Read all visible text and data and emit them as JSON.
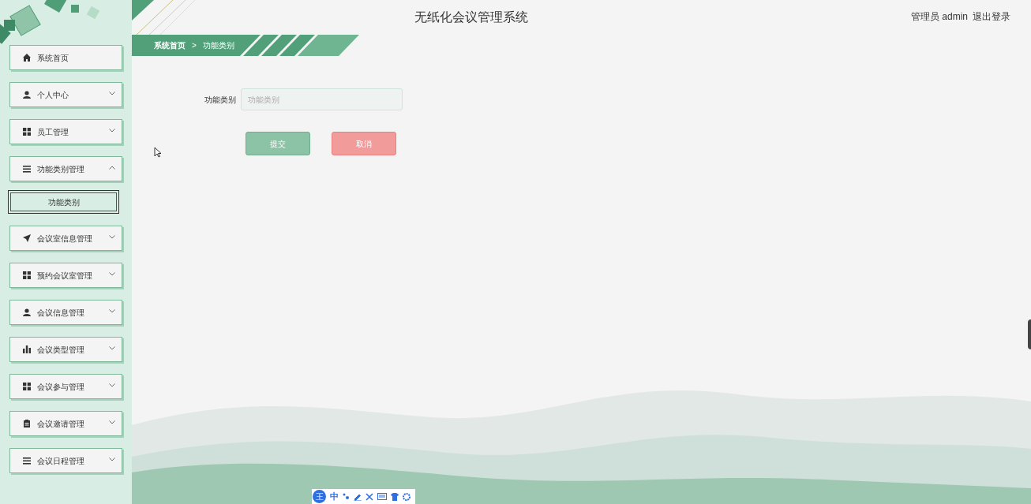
{
  "header": {
    "title": "无纸化会议管理系统",
    "user": "管理员 admin",
    "logout": "退出登录"
  },
  "breadcrumb": [
    "系统首页",
    "功能类别"
  ],
  "breadcrumb_separator": ">",
  "sidebar": {
    "items": [
      {
        "kind": "link",
        "label": "系统首页"
      },
      {
        "kind": "menu",
        "label": "个人中心",
        "expanded": false
      },
      {
        "kind": "menu",
        "label": "员工管理",
        "expanded": false
      },
      {
        "kind": "menu",
        "label": "功能类别管理",
        "expanded": true,
        "children": [
          {
            "label": "功能类别",
            "selected": true
          }
        ]
      },
      {
        "kind": "menu",
        "label": "会议室信息管理",
        "expanded": false
      },
      {
        "kind": "menu",
        "label": "预约会议室管理",
        "expanded": false
      },
      {
        "kind": "menu",
        "label": "会议信息管理",
        "expanded": false
      },
      {
        "kind": "menu",
        "label": "会议类型管理",
        "expanded": false
      },
      {
        "kind": "menu",
        "label": "会议参与管理",
        "expanded": false
      },
      {
        "kind": "menu",
        "label": "会议邀请管理",
        "expanded": false
      },
      {
        "kind": "menu",
        "label": "会议日程管理",
        "expanded": false
      }
    ]
  },
  "form": {
    "fields": [
      {
        "label": "功能类别",
        "placeholder": "功能类别"
      }
    ],
    "buttons": [
      {
        "kind": "submit",
        "label": "提交"
      },
      {
        "kind": "cancel",
        "label": "取消"
      }
    ]
  },
  "ime_toolbar": {
    "logo": "王",
    "mode": "中"
  }
}
